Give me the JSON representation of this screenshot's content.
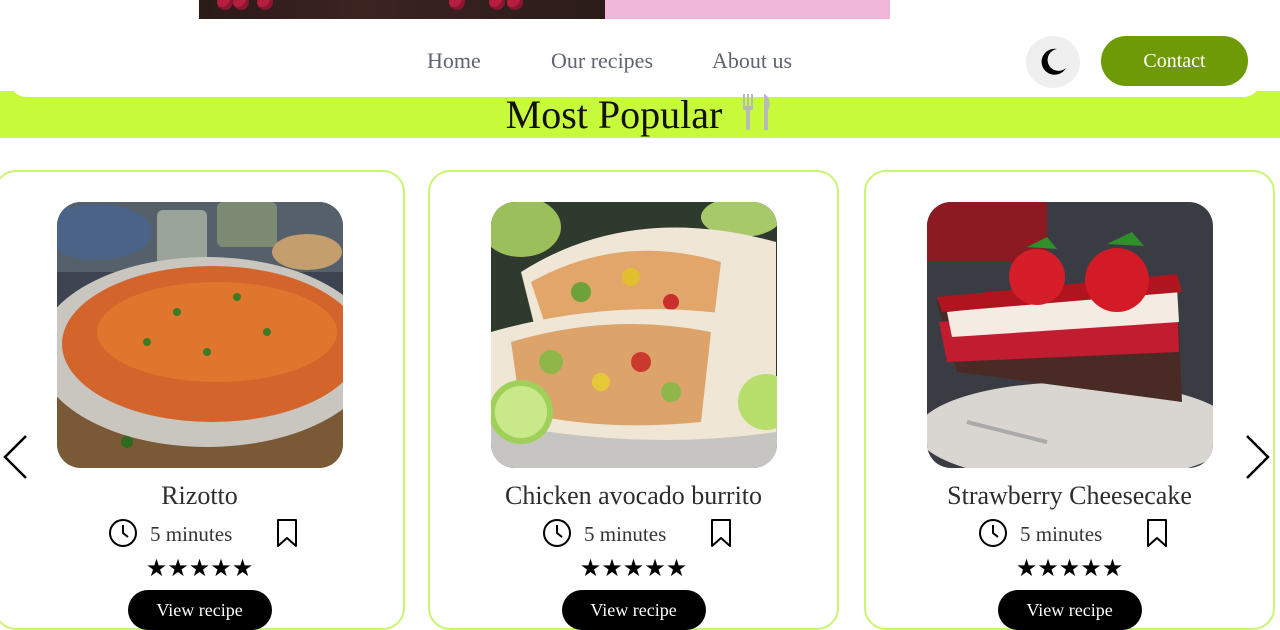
{
  "nav": {
    "links": [
      "Home",
      "Our recipes",
      "About us"
    ],
    "theme_toggle_icon": "moon-icon",
    "contact_label": "Contact",
    "accent_color": "#6f9a07"
  },
  "section": {
    "title": "Most Popular",
    "icon": "fork-knife-icon",
    "band_color": "#c8fa3c"
  },
  "cards": [
    {
      "title": "Rizotto",
      "time": "5 minutes",
      "stars": "★★★★★",
      "button": "View recipe"
    },
    {
      "title": "Chicken avocado burrito",
      "time": "5 minutes",
      "stars": "★★★★★",
      "button": "View recipe"
    },
    {
      "title": "Strawberry Cheesecake",
      "time": "5 minutes",
      "stars": "★★★★★",
      "button": "View recipe"
    }
  ],
  "carousel": {
    "prev_icon": "chevron-left-icon",
    "next_icon": "chevron-right-icon"
  }
}
